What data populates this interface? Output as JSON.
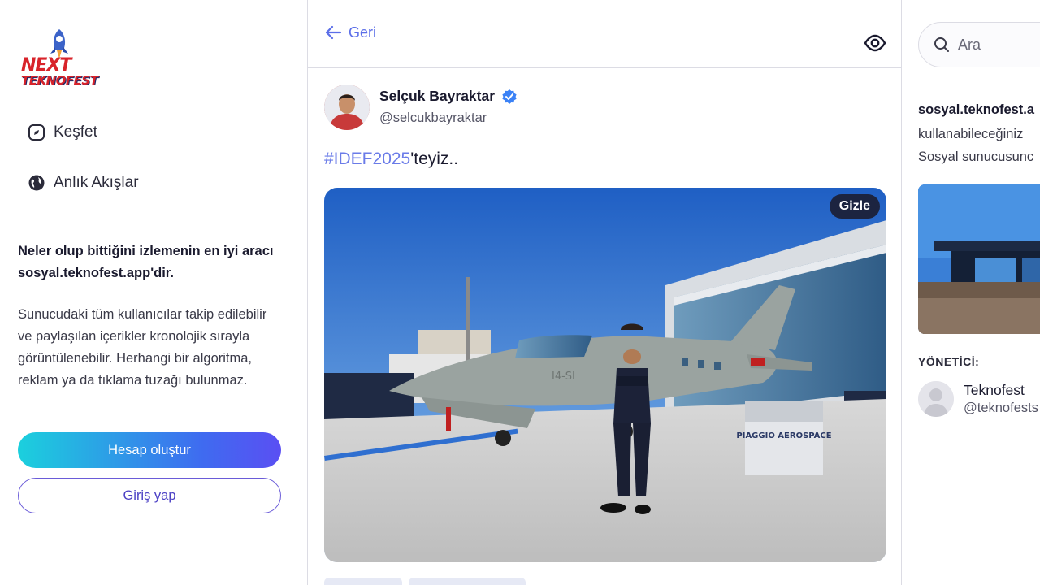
{
  "brand": {
    "logo_line1": "NEXT",
    "logo_line2": "TEKNOFEST"
  },
  "nav": {
    "items": [
      {
        "label": "Keşfet",
        "icon": "explore-icon"
      },
      {
        "label": "Anlık Akışlar",
        "icon": "globe-icon"
      }
    ]
  },
  "promo": {
    "title": "Neler olup bittiğini izlemenin en iyi aracı sosyal.teknofest.app'dir.",
    "text": "Sunucudaki tüm kullanıcılar takip edilebilir ve paylaşılan içerikler kronolojik sırayla görüntülenebilir. Herhangi bir algoritma, reklam ya da tıklama tuzağı bulunmaz.",
    "create_account": "Hesap oluştur",
    "login": "Giriş yap"
  },
  "topbar": {
    "back_label": "Geri",
    "visibility_icon": "eye-icon"
  },
  "post": {
    "author_name": "Selçuk Bayraktar",
    "author_handle": "@selcukbayraktar",
    "verified": true,
    "hashtag": "#IDEF2025",
    "text_after_hashtag": "'teyiz..",
    "media_hide_label": "Gizle",
    "media_sign_text": "PIAGGIO AEROSPACE",
    "media_aircraft_marking": "I4-SI"
  },
  "sidebar_right": {
    "search_placeholder": "Ara",
    "server_name": "sosyal.teknofest.a",
    "server_desc_line1": "kullanabileceğiniz",
    "server_desc_line2": "Sosyal sunucusunc",
    "admin_label": "YÖNETİCİ:",
    "admin_name": "Teknofest",
    "admin_handle": "@teknofests"
  },
  "colors": {
    "accent": "#5b6ee8",
    "primary_gradient_start": "#1bd0dd",
    "primary_gradient_end": "#5a4ff3",
    "verified": "#3b82f6",
    "logo_red": "#d8232a"
  }
}
